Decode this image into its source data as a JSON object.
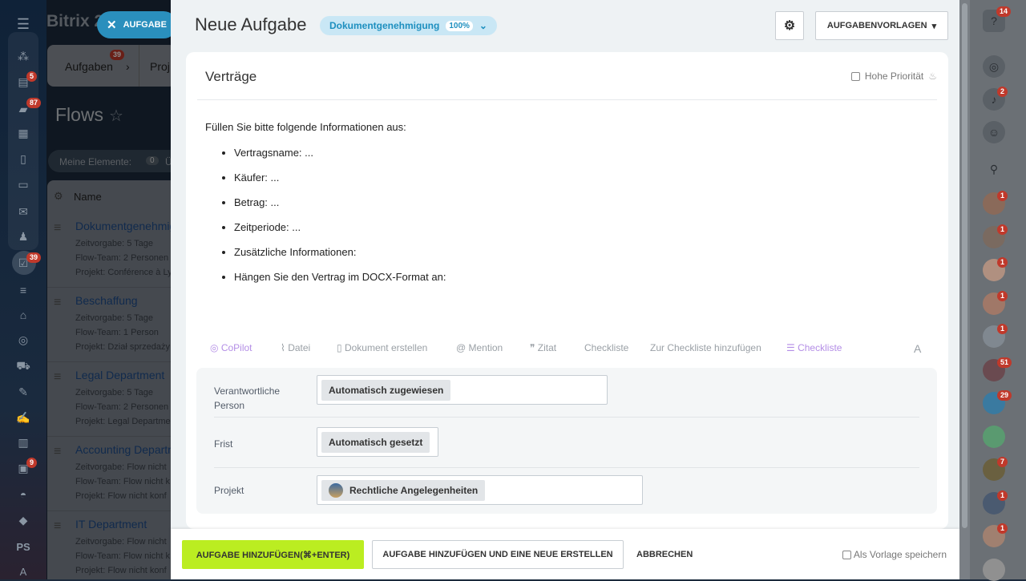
{
  "left_sidebar": {
    "badges": {
      "feed": "5",
      "chat": "87",
      "tasks": "39",
      "contacts": "9"
    },
    "ps": "PS",
    "a": "A"
  },
  "background": {
    "logo": "Bitrix 2",
    "close_tab": "AUFGABE",
    "nav_tasks": "Aufgaben",
    "nav_tasks_count": "39",
    "nav_projects": "Proj",
    "page_title": "Flows",
    "filter_label": "Meine Elemente:",
    "filter_count": "0",
    "filter_more": "Ü",
    "col_name": "Name",
    "flows": [
      {
        "name": "Dokumentgenehmig",
        "l1": "Zeitvorgabe: 5 Tage",
        "l2": "Flow-Team: 2 Personen",
        "l3": "Projekt: Conférence à Ly"
      },
      {
        "name": "Beschaffung",
        "l1": "Zeitvorgabe: 5 Tage",
        "l2": "Flow-Team: 1 Person",
        "l3": "Projekt: Dział sprzedaży"
      },
      {
        "name": "Legal Department",
        "l1": "Zeitvorgabe: 5 Tage",
        "l2": "Flow-Team: 2 Personen",
        "l3": "Projekt: Legal Departme"
      },
      {
        "name": "Accounting Departm",
        "l1": "Zeitvorgabe: Flow nicht",
        "l2": "Flow-Team: Flow nicht k",
        "l3": "Projekt: Flow nicht konf"
      },
      {
        "name": "IT Department",
        "l1": "Zeitvorgabe: Flow nicht",
        "l2": "Flow-Team: Flow nicht k",
        "l3": "Projekt: Flow nicht konf"
      }
    ]
  },
  "modal": {
    "title": "Neue Aufgabe",
    "flow_tag": "Dokumentgenehmigung",
    "flow_pct": "100%",
    "templates_button": "AUFGABENVORLAGEN",
    "task_title": "Verträge",
    "priority_label": "Hohe Priorität",
    "description_intro": "Füllen Sie bitte folgende Informationen aus:",
    "description_items": [
      "Vertragsname: ...",
      "Käufer: ...",
      "Betrag: ...",
      "Zeitperiode: ...",
      "Zusätzliche Informationen:",
      "Hängen Sie den Vertrag im DOCX-Format an:"
    ],
    "toolbar": {
      "copilot": "CoPilot",
      "file": "Datei",
      "create_doc": "Dokument erstellen",
      "mention": "Mention",
      "quote": "Zitat",
      "checklist": "Checkliste",
      "add_checklist": "Zur Checkliste hinzufügen",
      "checklist2": "Checkliste",
      "font": "A"
    },
    "fields": {
      "responsible_label": "Verantwortliche Person",
      "responsible_value": "Automatisch zugewiesen",
      "deadline_label": "Frist",
      "deadline_value": "Automatisch gesetzt",
      "project_label": "Projekt",
      "project_value": "Rechtliche Angelegenheiten"
    },
    "footer": {
      "add": "AUFGABE HINZUFÜGEN(⌘+ENTER)",
      "add_new": "AUFGABE HINZUFÜGEN UND EINE NEUE ERSTELLEN",
      "cancel": "ABBRECHEN",
      "save_template": "Als Vorlage speichern"
    }
  },
  "right_sidebar": {
    "help_badge": "14",
    "notif_badge": "2",
    "avatar_badges": [
      "1",
      "1",
      "1",
      "1",
      "1",
      "51",
      "29",
      "",
      "7",
      "1",
      "1",
      ""
    ]
  }
}
